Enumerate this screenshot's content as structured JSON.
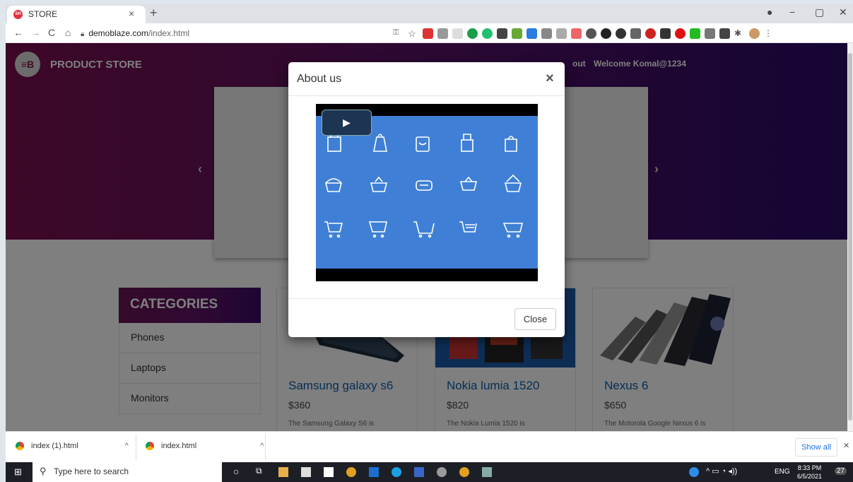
{
  "browser": {
    "tab_title": "STORE",
    "tab_favicon_text": "SH",
    "new_tab": "+",
    "tab_close": "×",
    "url_host": "demoblaze.com",
    "url_path": "/index.html",
    "nav": {
      "back": "←",
      "forward": "→",
      "reload": "C",
      "home": "⌂"
    },
    "window": {
      "minimize": "−",
      "maximize": "▢",
      "close": "✕"
    }
  },
  "site": {
    "brand_logo_text": "≡B",
    "brand_name": "PRODUCT STORE",
    "nav_visible_fragment": "out",
    "welcome": "Welcome Komal@1234",
    "carousel_prev": "‹",
    "carousel_next": "›",
    "categories": {
      "heading": "CATEGORIES",
      "items": [
        "Phones",
        "Laptops",
        "Monitors"
      ]
    },
    "products": [
      {
        "name": "Samsung galaxy s6",
        "price": "$360",
        "desc": "The Samsung Galaxy S6 is"
      },
      {
        "name": "Nokia lumia 1520",
        "price": "$820",
        "desc": "The Nokia Lumia 1520 is"
      },
      {
        "name": "Nexus 6",
        "price": "$650",
        "desc": "The Motorola Google Nexus 6 is"
      }
    ]
  },
  "modal": {
    "title": "About us",
    "close_x": "×",
    "close_button": "Close",
    "video_play": "▶"
  },
  "downloads": {
    "items": [
      {
        "name": "index (1).html",
        "chevron": "^"
      },
      {
        "name": "index.html",
        "chevron": "^"
      }
    ],
    "show_all": "Show all",
    "close": "✕"
  },
  "taskbar": {
    "search_placeholder": "Type here to search",
    "lang": "ENG",
    "time": "8:33 PM",
    "date": "6/5/2021",
    "notifications": "27"
  }
}
